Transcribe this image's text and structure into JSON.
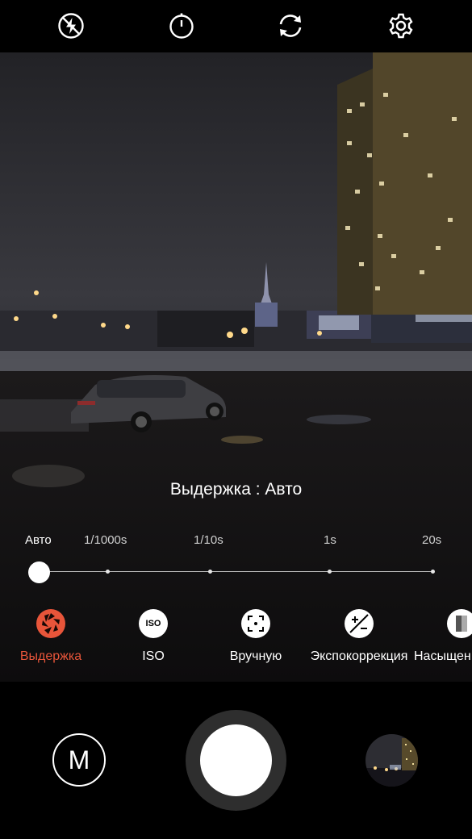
{
  "top_bar": {
    "icons": [
      "flash-auto-icon",
      "timer-icon",
      "switch-camera-icon",
      "settings-gear-icon"
    ]
  },
  "manual": {
    "parameter_label": "Выдержка : Авто",
    "slider": {
      "ticks": [
        "Авто",
        "1/1000s",
        "1/10s",
        "1s",
        "20s"
      ],
      "selected": "Авто",
      "selected_index": 0
    },
    "modes": [
      {
        "label": "Выдержка",
        "icon": "aperture-icon",
        "active": true
      },
      {
        "label": "ISO",
        "icon": "iso-icon",
        "badge": "ISO",
        "active": false
      },
      {
        "label": "Вручную",
        "icon": "manual-focus-icon",
        "active": false
      },
      {
        "label": "Экспокоррекция",
        "icon": "exposure-compensation-icon",
        "active": false
      },
      {
        "label": "Насыщен",
        "icon": "saturation-icon",
        "active": false
      }
    ]
  },
  "bottom_bar": {
    "mode_button_label": "M",
    "gallery_icon": "gallery-thumbnail"
  },
  "colors": {
    "accent": "#e8553a",
    "background": "#000000"
  }
}
